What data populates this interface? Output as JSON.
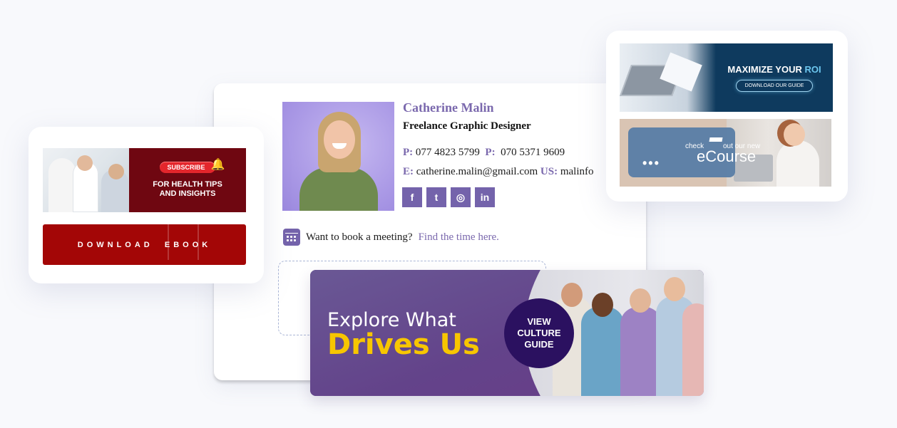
{
  "signature": {
    "name": "Catherine Malin",
    "job_title": "Freelance Graphic Designer",
    "phone_label_1": "P:",
    "phone_1": "077 4823 5799",
    "phone_label_2": "P:",
    "phone_2": "070 5371 9609",
    "email_label": "E:",
    "email": "catherine.malin@gmail.com",
    "website_label": "US:",
    "website": "malinfo",
    "social_icons": [
      "facebook-icon",
      "twitter-icon",
      "instagram-icon",
      "linkedin-icon"
    ],
    "social_glyphs": [
      "f",
      "t",
      "◎",
      "in"
    ],
    "meeting_text": "Want to book a meeting?",
    "meeting_link": "Find the time here.",
    "accent_color": "#7463ab"
  },
  "left_banners": {
    "subscribe_label": "SUBSCRIBE",
    "health_caption_1": "FOR HEALTH TIPS",
    "health_caption_2": "AND INSIGHTS",
    "download_label": "DOWNLOAD  EBOOK"
  },
  "right_banners": {
    "roi_headline": "MAXIMIZE YOUR",
    "roi_highlight": "ROI",
    "roi_button": "DOWNLOAD OUR GUIDE",
    "ecourse_dots": "•••",
    "ecourse_check": "check",
    "ecourse_out": "out our new",
    "ecourse_word": "eCourse"
  },
  "culture_banner": {
    "line_1": "Explore What",
    "line_2": "Drives Us",
    "cta_1": "VIEW",
    "cta_2": "CULTURE",
    "cta_3": "GUIDE"
  }
}
